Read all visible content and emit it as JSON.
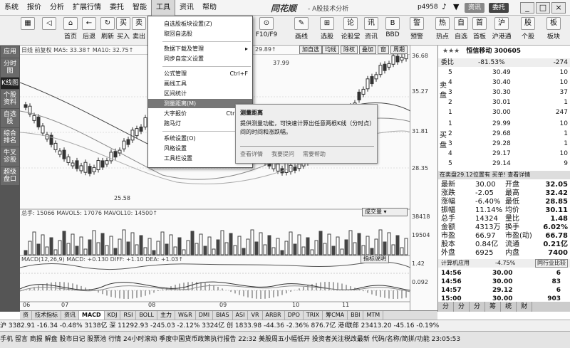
{
  "menu": [
    "系统",
    "报价",
    "分析",
    "扩展行情",
    "委托",
    "智能",
    "工具",
    "资讯",
    "帮助"
  ],
  "brand": "同花顺",
  "brand_sub": "- A股技术分析",
  "account": "p4958",
  "win": {
    "buttons": [
      "_",
      "□",
      "×"
    ],
    "pill1": "资讯",
    "pill2": "委托"
  },
  "toolbar": {
    "left": [
      {
        "label": "",
        "icon": "▦"
      },
      {
        "label": "",
        "icon": "◁"
      },
      {
        "label": "首页",
        "icon": "⌂"
      },
      {
        "label": "后退",
        "icon": "←"
      },
      {
        "label": "刷新",
        "icon": "↻"
      },
      {
        "label": "买入",
        "icon": "买"
      },
      {
        "label": "卖出",
        "icon": "卖"
      }
    ],
    "right": [
      {
        "label": "F10/F9",
        "icon": "⊙"
      },
      {
        "label": "画线",
        "icon": "✎"
      },
      {
        "label": "选股",
        "icon": "⊞"
      },
      {
        "label": "论股堂",
        "icon": "论"
      },
      {
        "label": "资讯",
        "icon": "讯"
      },
      {
        "label": "BBD",
        "icon": "B"
      },
      {
        "label": "预警",
        "icon": "警"
      },
      {
        "label": "热点",
        "icon": "热"
      },
      {
        "label": "自选",
        "icon": "自"
      },
      {
        "label": "首板",
        "icon": "首"
      },
      {
        "label": "沪港通",
        "icon": "沪"
      },
      {
        "label": "个股",
        "icon": "股"
      },
      {
        "label": "板块",
        "icon": "板"
      }
    ]
  },
  "sidebar": [
    {
      "label": "应用",
      "on": false
    },
    {
      "label": "分时图",
      "on": false
    },
    {
      "label": "K线图",
      "on": true
    },
    {
      "label": "个股资料",
      "on": false
    },
    {
      "label": "自选股",
      "on": false
    },
    {
      "label": "综合排名",
      "on": false
    },
    {
      "label": "牛叉诊股",
      "on": false
    },
    {
      "label": "超级盘口",
      "on": false
    }
  ],
  "chart": {
    "header": "日线 前复权 MA5: 33.38↑ MA10: 32.75↑",
    "header2": "29.89↑",
    "panel_buttons": [
      "加自选",
      "均线",
      "除权",
      "叠加",
      "窗",
      "周期"
    ],
    "ma_labels": {
      "high_mark": "37.99",
      "low_mark": "25.58"
    },
    "price_axis": [
      "36.68",
      "35.27",
      "31.81",
      "28.35"
    ],
    "vol_header": "总手: 15066  MAVOL5: 17076  MAVOL10: 14500↑",
    "vol_dropdown": "成交量",
    "vol_axis": [
      "38418",
      "19504"
    ],
    "macd_header": "MACD(12,26,9) MACD: +0.130  DIFF: +1.10  DEA: +1.03↑",
    "macd_button": "指标说明",
    "macd_axis": [
      "1.42",
      "0.092"
    ],
    "x_axis": [
      "06",
      "07",
      "08",
      "09",
      "10",
      "11"
    ]
  },
  "chart_data": {
    "type": "candlestick",
    "price_series": {
      "ma5_last": 33.38,
      "ma10_last": 32.75,
      "high": 37.99,
      "low": 25.58
    },
    "macd": {
      "macd": 0.13,
      "diff": 1.1,
      "dea": 1.03
    },
    "volume": {
      "total": 15066,
      "mavol5": 17076,
      "mavol10": 14500
    }
  },
  "dropdown": {
    "items": [
      {
        "label": "自选股板块设置(Z)",
        "sc": "",
        "arr": false,
        "sel": false,
        "sep_after": false
      },
      {
        "label": "取回自选股",
        "sc": "",
        "arr": false,
        "sel": false,
        "sep_after": true
      },
      {
        "label": "数据下载及管理",
        "sc": "",
        "arr": true,
        "sel": false,
        "sep_after": false
      },
      {
        "label": "同步自定义设置",
        "sc": "",
        "arr": false,
        "sel": false,
        "sep_after": true
      },
      {
        "label": "公式管理",
        "sc": "Ctrl+F",
        "arr": false,
        "sel": false,
        "sep_after": false
      },
      {
        "label": "画线工具",
        "sc": "",
        "arr": false,
        "sel": false,
        "sep_after": false
      },
      {
        "label": "区间统计",
        "sc": "",
        "arr": false,
        "sel": false,
        "sep_after": false
      },
      {
        "label": "测量距离(M)",
        "sc": "",
        "arr": false,
        "sel": true,
        "sep_after": false
      },
      {
        "label": "大字报价",
        "sc": "Ctrl+F6",
        "arr": false,
        "sel": false,
        "sep_after": false
      },
      {
        "label": "跑马灯",
        "sc": "",
        "arr": false,
        "sel": false,
        "sep_after": true
      },
      {
        "label": "系统设置(O)",
        "sc": "",
        "arr": false,
        "sel": false,
        "sep_after": false
      },
      {
        "label": "风格设置",
        "sc": "",
        "arr": true,
        "sel": false,
        "sep_after": false
      },
      {
        "label": "工具栏设置",
        "sc": "",
        "arr": true,
        "sel": false,
        "sep_after": false
      }
    ]
  },
  "tooltip": {
    "title": "测量距离",
    "body": "提供测量功能，可快速计算出任意两根K线（分时点）间的时间和涨跌幅。",
    "links": [
      "查看详情",
      "我要提问",
      "需要帮助"
    ]
  },
  "quote": {
    "stars": "★★★",
    "name": "恒信移动 300605",
    "webi": "-81.53%",
    "webi_label": "委比",
    "webi_val": "-274",
    "sell": [
      {
        "n": "5",
        "p": "30.49",
        "v": "10"
      },
      {
        "n": "4",
        "p": "30.40",
        "v": "10"
      },
      {
        "n": "3",
        "p": "30.30",
        "v": "37"
      },
      {
        "n": "2",
        "p": "30.01",
        "v": "1"
      },
      {
        "n": "1",
        "p": "30.00",
        "v": "247"
      }
    ],
    "buy": [
      {
        "n": "1",
        "p": "29.99",
        "v": "10"
      },
      {
        "n": "2",
        "p": "29.68",
        "v": "1"
      },
      {
        "n": "3",
        "p": "29.28",
        "v": "1"
      },
      {
        "n": "4",
        "p": "29.17",
        "v": "10"
      },
      {
        "n": "5",
        "p": "29.14",
        "v": "9"
      }
    ],
    "sell_label": "卖盘",
    "buy_label": "买盘",
    "tabs": "在卖盘29.12位置有  买单!  查看详情",
    "stats": [
      [
        "最新",
        "30.00",
        "开盘",
        "32.05"
      ],
      [
        "涨跌",
        "-2.05",
        "最高",
        "32.42"
      ],
      [
        "涨幅",
        "-6.40%",
        "最低",
        "28.85"
      ],
      [
        "振幅",
        "11.14%",
        "均价",
        "30.11"
      ],
      [
        "总手",
        "14324",
        "量比",
        "1.48"
      ],
      [
        "金额",
        "4313万",
        "换手",
        "6.02%"
      ],
      [
        "市盈",
        "66.97",
        "市盈(动)",
        "66.78"
      ],
      [
        "股本",
        "0.84亿",
        "流通",
        "0.21亿"
      ],
      [
        "外盘",
        "6925",
        "内盘",
        "7400"
      ]
    ],
    "calc_label": "计算机应用",
    "calc_val": "-4.75%",
    "calc_link": "同行业比较",
    "ticks": [
      {
        "t": "14:56",
        "p": "30.00",
        "v": "6"
      },
      {
        "t": "14:56",
        "p": "30.00",
        "v": "83"
      },
      {
        "t": "14:57",
        "p": "29.12",
        "v": "6"
      },
      {
        "t": "15:00",
        "p": "30.00",
        "v": "903"
      }
    ],
    "bottom_tabs": [
      "分",
      "分",
      "分",
      "筹",
      "统",
      "财"
    ]
  },
  "bottom_tabs": [
    "资",
    "技术指标",
    "资讯",
    "MACD",
    "KDJ",
    "RSI",
    "BOLL",
    "主力",
    "W&R",
    "DMI",
    "BIAS",
    "ASI",
    "VR",
    "ARBR",
    "DPO",
    "TRIX",
    "筹CMA",
    "BBI",
    "MTM"
  ],
  "status1": "沪 3382.91  -16.34  -0.48%   3138亿 深 11292.93  -245.03  -2.12%   3324亿 创  1833.98  -44.36  -2.36%   876.7亿 港I联郎  23413.20  -45.16  -0.19%",
  "status2": "手机  留言  商报  解盘  股市日记  股票池  行情  24小时滚动   季度中国货币政策执行报告   22:32 美股周五小幅低开 投资者关注税改最新   代码/名称/简拼/功能   23:05:53"
}
